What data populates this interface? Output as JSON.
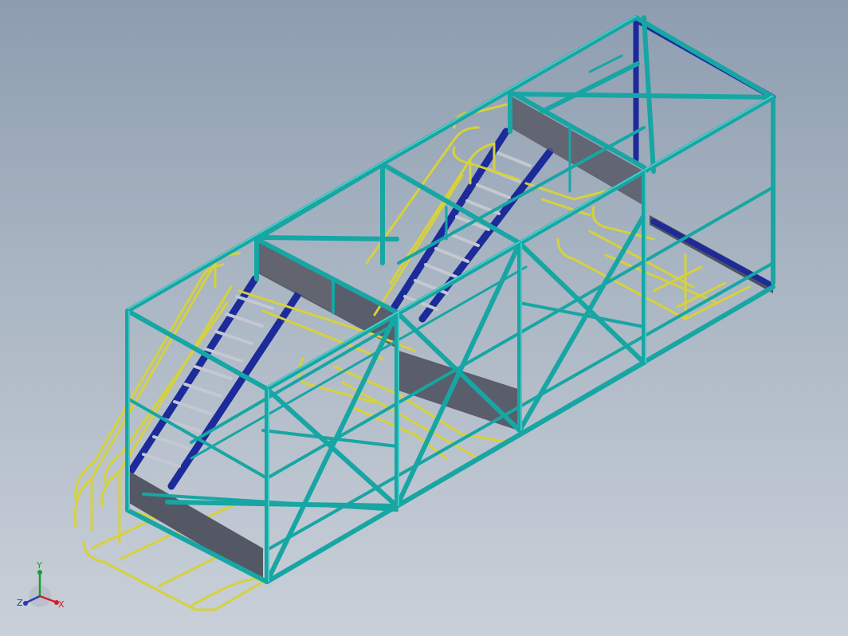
{
  "scene": {
    "model": "stair-tower-frame",
    "colors": {
      "frame": "#17a6a4",
      "frame_light": "#4fd2cf",
      "stringer": "#1c2a9a",
      "handrail": "#d6d23a",
      "handrail_dark": "#9c9a22",
      "kickplate": "#5a5d6b",
      "tread": "#b7bcc6",
      "background_top": "#8d9db0",
      "background_bottom": "#c9d0d9"
    }
  },
  "triad": {
    "x_label": "X",
    "y_label": "Y",
    "z_label": "Z",
    "x_color": "#d0202a",
    "y_color": "#1f9a2f",
    "z_color": "#2b3bb5"
  }
}
